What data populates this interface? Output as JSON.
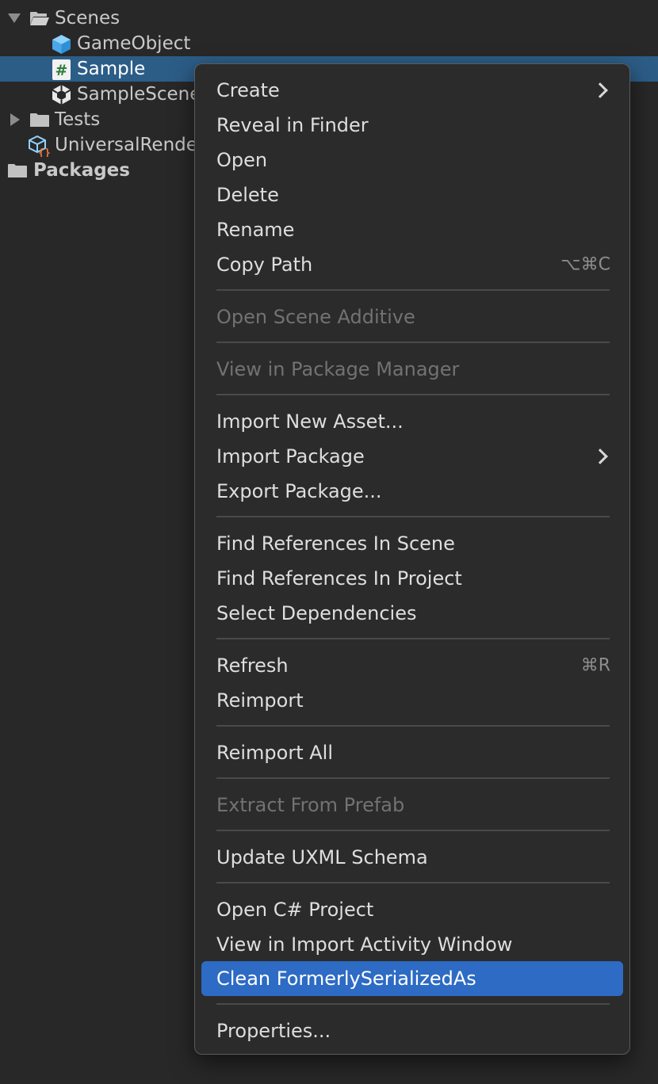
{
  "project_tree": {
    "scenes_folder": "Scenes",
    "items": [
      {
        "label": "GameObject",
        "icon": "prefab-cube-icon"
      },
      {
        "label": "Sample",
        "icon": "csharp-script-icon"
      },
      {
        "label": "SampleScene",
        "icon": "unity-scene-icon"
      }
    ],
    "tests_folder": "Tests",
    "render_asset": "UniversalRende",
    "packages": "Packages"
  },
  "context_menu": {
    "items": [
      {
        "label": "Create",
        "submenu": true
      },
      {
        "label": "Reveal in Finder"
      },
      {
        "label": "Open"
      },
      {
        "label": "Delete"
      },
      {
        "label": "Rename"
      },
      {
        "label": "Copy Path",
        "shortcut": "⌥⌘C"
      },
      {
        "label": "Open Scene Additive",
        "disabled": true
      },
      {
        "label": "View in Package Manager",
        "disabled": true
      },
      {
        "label": "Import New Asset..."
      },
      {
        "label": "Import Package",
        "submenu": true
      },
      {
        "label": "Export Package..."
      },
      {
        "label": "Find References In Scene"
      },
      {
        "label": "Find References In Project"
      },
      {
        "label": "Select Dependencies"
      },
      {
        "label": "Refresh",
        "shortcut": "⌘R"
      },
      {
        "label": "Reimport"
      },
      {
        "label": "Reimport All"
      },
      {
        "label": "Extract From Prefab",
        "disabled": true
      },
      {
        "label": "Update UXML Schema"
      },
      {
        "label": "Open C# Project"
      },
      {
        "label": "View in Import Activity Window"
      },
      {
        "label": "Clean FormerlySerializedAs",
        "highlighted": true
      },
      {
        "label": "Properties..."
      }
    ]
  },
  "colors": {
    "panel_bg": "#282828",
    "selection": "#2c5d87",
    "menu_bg": "#2b2b2b",
    "menu_highlight": "#2d6bc4",
    "disabled_text": "#727272"
  }
}
